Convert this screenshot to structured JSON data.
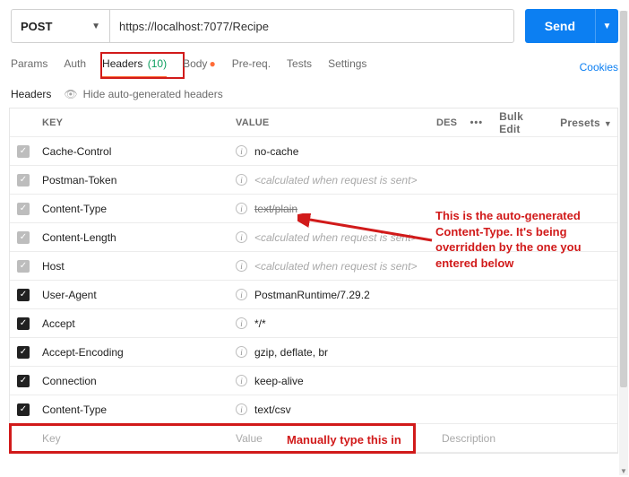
{
  "request": {
    "method": "POST",
    "url": "https://localhost:7077/Recipe",
    "send_label": "Send"
  },
  "tabs": {
    "params": "Params",
    "auth": "Auth",
    "headers": "Headers",
    "headers_count": "(10)",
    "body": "Body",
    "prereq": "Pre-req.",
    "tests": "Tests",
    "settings": "Settings",
    "cookies": "Cookies"
  },
  "sub": {
    "title": "Headers",
    "hide": "Hide auto-generated headers"
  },
  "cols": {
    "key": "KEY",
    "value": "VALUE",
    "desc": "DES",
    "bulk": "Bulk Edit",
    "presets": "Presets"
  },
  "rows": [
    {
      "enabled": "gray",
      "key": "Cache-Control",
      "value": "no-cache",
      "calc": false,
      "struck": false
    },
    {
      "enabled": "gray",
      "key": "Postman-Token",
      "value": "<calculated when request is sent>",
      "calc": true,
      "struck": false
    },
    {
      "enabled": "gray",
      "key": "Content-Type",
      "value": "text/plain",
      "calc": false,
      "struck": true
    },
    {
      "enabled": "gray",
      "key": "Content-Length",
      "value": "<calculated when request is sent>",
      "calc": true,
      "struck": false
    },
    {
      "enabled": "gray",
      "key": "Host",
      "value": "<calculated when request is sent>",
      "calc": true,
      "struck": false
    },
    {
      "enabled": "on",
      "key": "User-Agent",
      "value": "PostmanRuntime/7.29.2",
      "calc": false,
      "struck": false
    },
    {
      "enabled": "on",
      "key": "Accept",
      "value": "*/*",
      "calc": false,
      "struck": false
    },
    {
      "enabled": "on",
      "key": "Accept-Encoding",
      "value": "gzip, deflate, br",
      "calc": false,
      "struck": false
    },
    {
      "enabled": "on",
      "key": "Connection",
      "value": "keep-alive",
      "calc": false,
      "struck": false
    },
    {
      "enabled": "on",
      "key": "Content-Type",
      "value": "text/csv",
      "calc": false,
      "struck": false
    }
  ],
  "new_row": {
    "key_ph": "Key",
    "value_ph": "Value",
    "desc_ph": "Description"
  },
  "annot": {
    "a1": "This is the auto-generated Content-Type. It's being overridden by the one you entered below",
    "a2": "Manually type this in"
  }
}
